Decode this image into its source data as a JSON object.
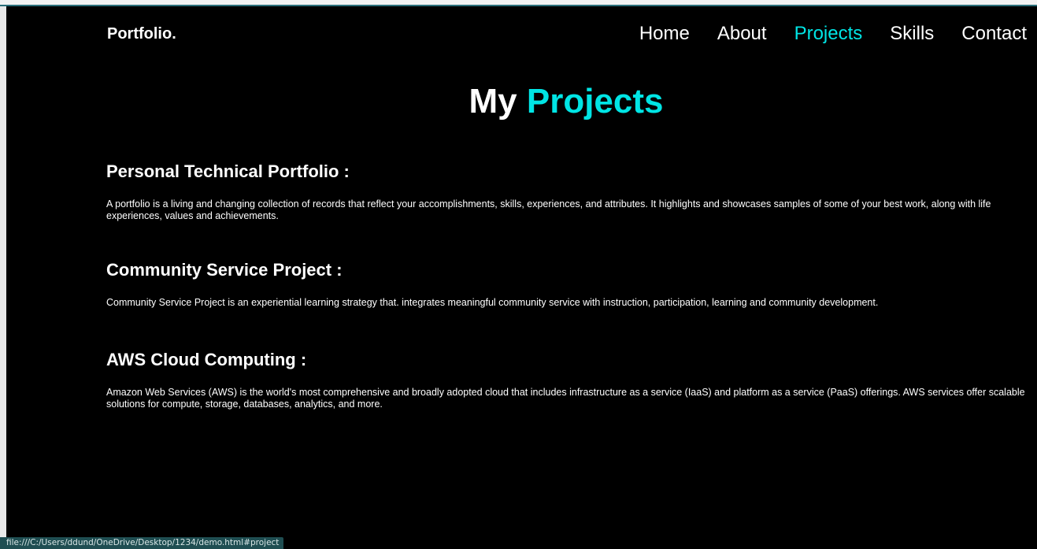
{
  "brand": {
    "logo_text": "Portfolio."
  },
  "nav": {
    "items": [
      {
        "label": "Home"
      },
      {
        "label": "About"
      },
      {
        "label": "Projects"
      },
      {
        "label": "Skills"
      },
      {
        "label": "Contact"
      }
    ],
    "active_index": 2
  },
  "heading": {
    "prefix": "My",
    "accent": "Projects"
  },
  "projects": [
    {
      "title": "Personal Technical Portfolio :",
      "description": "A portfolio is a living and changing collection of records that reflect your accomplishments, skills, experiences, and attributes. It highlights and showcases samples of some of your best work, along with life experiences, values and achievements."
    },
    {
      "title": "Community Service Project :",
      "description": "Community Service Project is an experiential learning strategy that. integrates meaningful community service with instruction, participation, learning and community development."
    },
    {
      "title": "AWS Cloud Computing :",
      "description": "Amazon Web Services (AWS) is the world's most comprehensive and broadly adopted cloud that includes infrastructure as a service (IaaS) and platform as a service (PaaS) offerings. AWS services offer scalable solutions for compute, storage, databases, analytics, and more."
    }
  ],
  "status_bar": {
    "url": "file:///C:/Users/ddund/OneDrive/Desktop/1234/demo.html#project"
  },
  "colors": {
    "background": "#000000",
    "text": "#ffffff",
    "accent": "#00e5e5"
  }
}
